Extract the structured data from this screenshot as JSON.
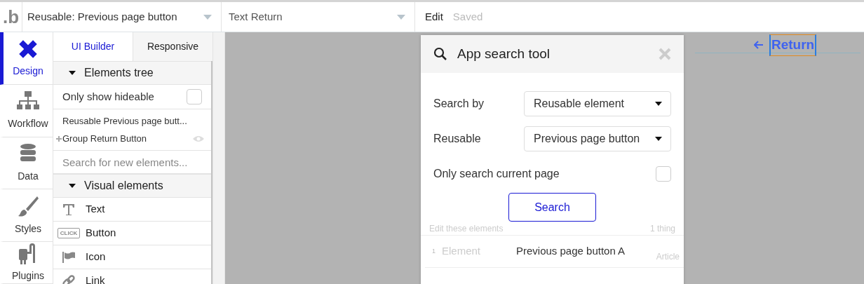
{
  "top_bar": {
    "logo": ".b",
    "page_selector": "Reusable: Previous page button",
    "element_selector": "Text Return",
    "actions": [
      {
        "label": "Edit",
        "disabled": false
      },
      {
        "label": "Saved",
        "disabled": true
      }
    ]
  },
  "rail": [
    {
      "label": "Design",
      "kind": "design",
      "selected": true
    },
    {
      "label": "Workflow",
      "kind": "workflow",
      "selected": false
    },
    {
      "label": "Data",
      "kind": "data",
      "selected": false
    },
    {
      "label": "Styles",
      "kind": "styles",
      "selected": false
    },
    {
      "label": "Plugins",
      "kind": "plugins",
      "selected": false
    }
  ],
  "panel": {
    "tabs": [
      {
        "label": "UI Builder",
        "selected": true
      },
      {
        "label": "Responsive",
        "selected": false
      }
    ],
    "elements_tree": {
      "title": "Elements tree",
      "expanded": true,
      "hideable_label": "Only show hideable",
      "hideable_checked": false,
      "items": [
        {
          "label": "Reusable Previous page butt...",
          "children": [
            {
              "label": "Group Return Button"
            }
          ]
        }
      ]
    },
    "search": {
      "placeholder": "Search for new elements..."
    },
    "visual_elements": {
      "title": "Visual elements",
      "expanded": true,
      "items": [
        {
          "label": "Text",
          "kind": "text"
        },
        {
          "label": "Button",
          "kind": "button",
          "icon_text": "CLICK"
        },
        {
          "label": "Icon",
          "kind": "icon"
        },
        {
          "label": "Link",
          "kind": "link"
        }
      ]
    }
  },
  "canvas": {
    "link": {
      "label": "Return",
      "selected": true
    }
  },
  "dialog": {
    "title": "App search tool",
    "fields": [
      {
        "label": "Search by",
        "value": "Reusable element"
      },
      {
        "label": "Reusable",
        "value": "Previous page button"
      }
    ],
    "only_current": {
      "label": "Only search current page",
      "checked": false
    },
    "button": "Search",
    "results_label": "Edit these elements",
    "results_count": "1 thing",
    "results": [
      {
        "index": "1",
        "type": "Element",
        "name": "Previous page button A",
        "page": "Article"
      }
    ]
  }
}
